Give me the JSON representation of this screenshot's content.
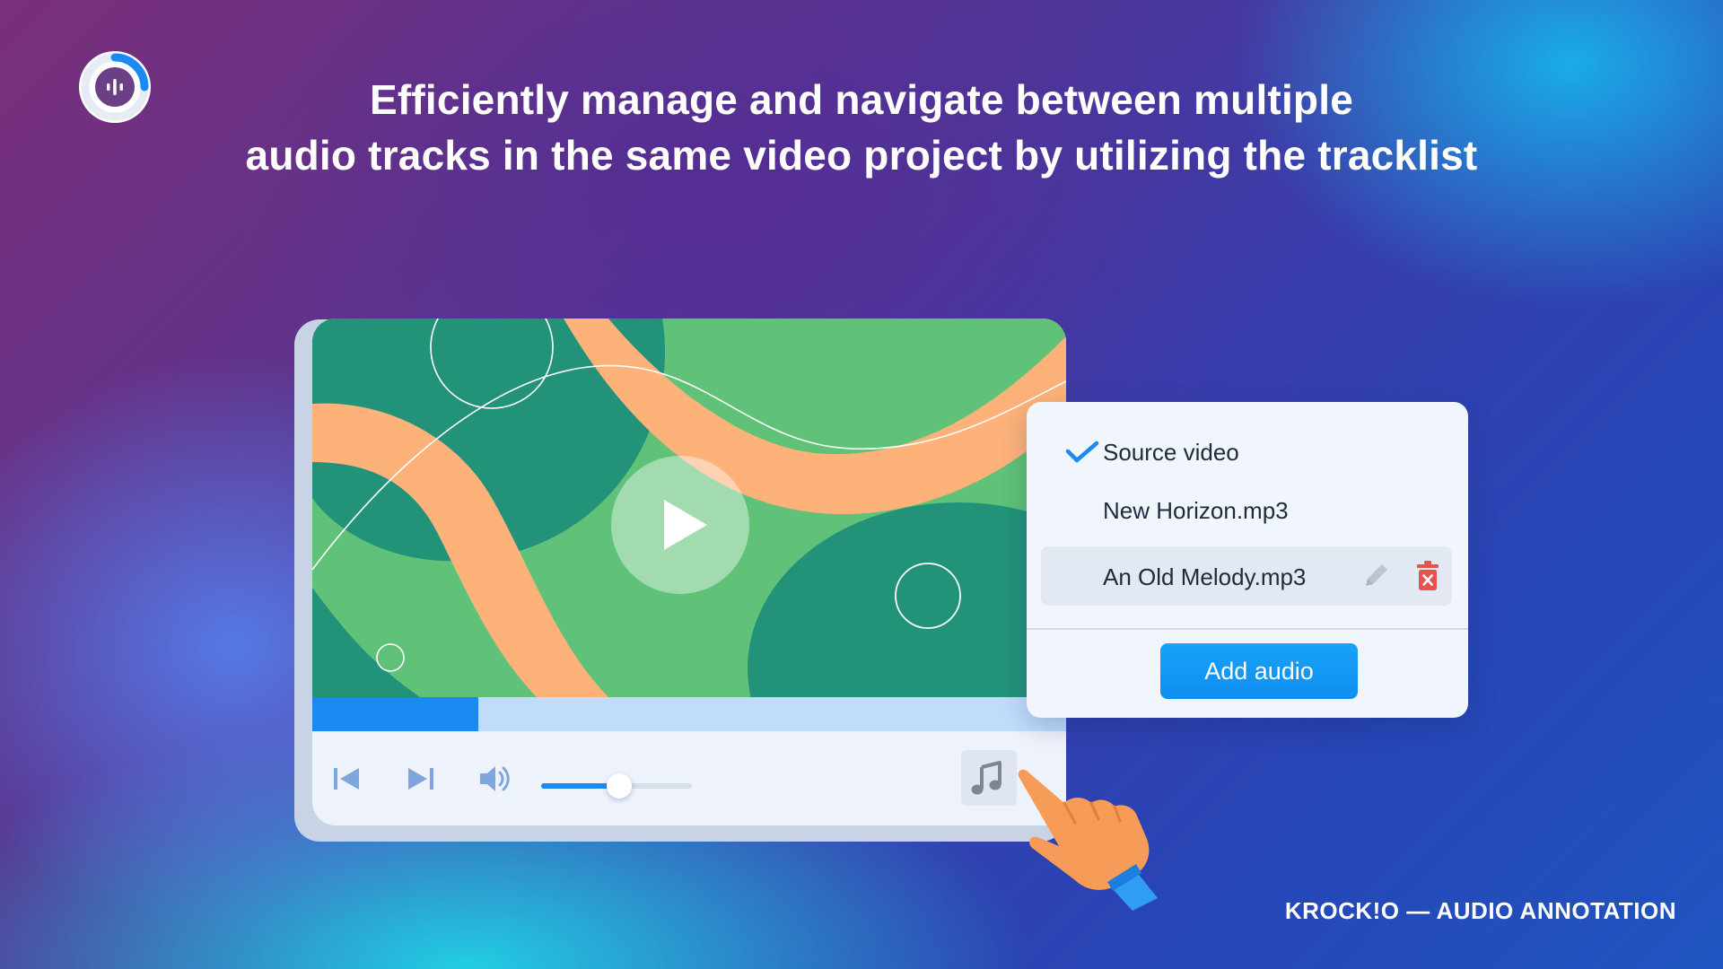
{
  "headline": {
    "line1": "Efficiently manage and navigate between multiple",
    "line2": "audio tracks in the same video project by utilizing the tracklist"
  },
  "brand": {
    "footer": "KROCK!O — AUDIO ANNOTATION",
    "logo_icon": "audio-waveform-ring-icon"
  },
  "player": {
    "progress_percent": 22,
    "volume_percent": 52,
    "controls": [
      "skip-back-icon",
      "skip-forward-icon",
      "volume-icon",
      "music-note-icon"
    ]
  },
  "tracklist": {
    "items": [
      {
        "label": "Source video",
        "checked": true
      },
      {
        "label": "New Horizon.mp3",
        "checked": false
      },
      {
        "label": "An Old Melody.mp3",
        "checked": false,
        "highlighted": true
      }
    ],
    "add_button_label": "Add audio"
  },
  "colors": {
    "accent_blue": "#1a8af2",
    "delete_red": "#e5534b",
    "video_green": "#5fc278",
    "video_dark_green": "#229379",
    "video_orange": "#fdb27a"
  }
}
